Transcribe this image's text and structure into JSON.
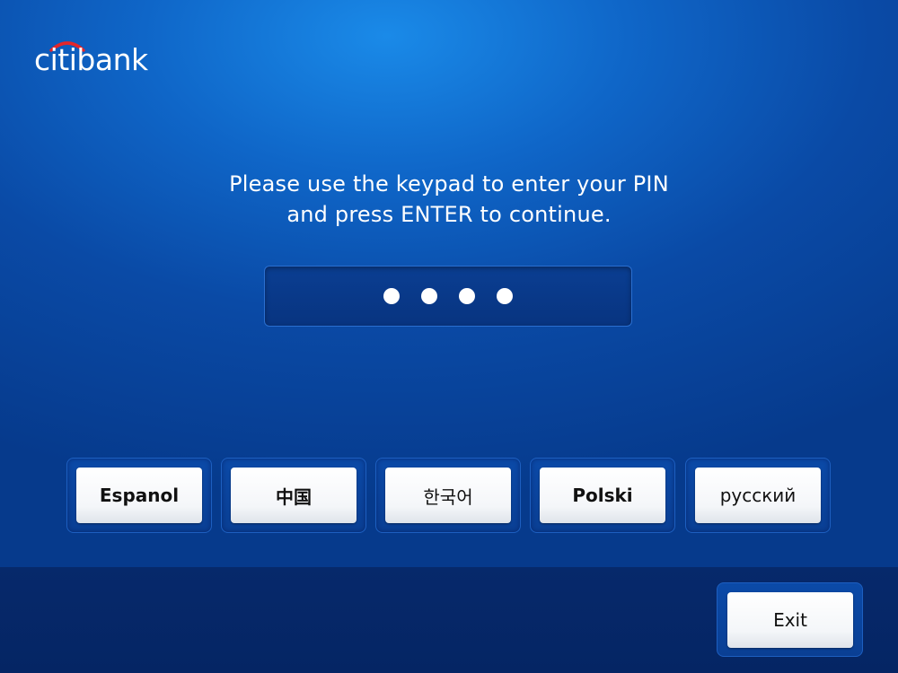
{
  "brand": {
    "name": "citibank",
    "arc_color": "#e3262b"
  },
  "instruction": {
    "line1": "Please use the keypad to enter your PIN",
    "line2": "and press ENTER to continue."
  },
  "pin": {
    "entered_digits": 4,
    "mask_char": "●"
  },
  "languages": [
    {
      "label": "Espanol"
    },
    {
      "label": "中国"
    },
    {
      "label": "한국어"
    },
    {
      "label": "Polski"
    },
    {
      "label": "русский"
    }
  ],
  "footer": {
    "exit_label": "Exit"
  },
  "colors": {
    "background_top": "#1a8ae8",
    "background_bottom": "#063a8c",
    "footer": "#052564",
    "button_face": "#ffffff",
    "button_text": "#111111"
  }
}
